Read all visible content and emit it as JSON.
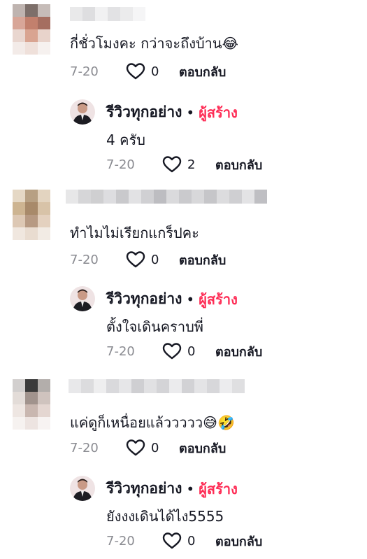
{
  "comments": [
    {
      "text": "กี่ชั่วโมงคะ กว่าจะถึงบ้าน😂",
      "date": "7-20",
      "likes": "0",
      "reply_label": "ตอบกลับ",
      "avatar_colors": [
        "#bfb4b0",
        "#7d6f6a",
        "#c6bcb8",
        "#d8a698",
        "#c2806d",
        "#a56e60",
        "#e9d6cf",
        "#d9a491",
        "#e8d3cb",
        "#f3ebe8",
        "#efe0da",
        "#f6f1ef"
      ],
      "reply": {
        "name": "รีวิวทุกอย่าง",
        "dot": "•",
        "creator_label": "ผู้สร้าง",
        "text": "4 ครับ",
        "date": "7-20",
        "likes": "2",
        "reply_label": "ตอบกลับ"
      }
    },
    {
      "text": "ทำไมไม่เรียกแกร็ปคะ",
      "date": "7-20",
      "likes": "0",
      "reply_label": "ตอบกลับ",
      "avatar_colors": [
        "#e5d8c5",
        "#b7a083",
        "#e3d4c0",
        "#cdb491",
        "#a88a6a",
        "#d8c3a8",
        "#ddc8b4",
        "#b79a83",
        "#e4d1bf",
        "#f0e7df",
        "#e9dcd0",
        "#f2ebe4"
      ],
      "reply": {
        "name": "รีวิวทุกอย่าง",
        "dot": "•",
        "creator_label": "ผู้สร้าง",
        "text": "ตั้งใจเดินคราบพี่",
        "date": "7-20",
        "likes": "0",
        "reply_label": "ตอบกลับ"
      }
    },
    {
      "text": "แค่ดูก็เหนื่อยแล้ววววว😅🤣",
      "date": "7-20",
      "likes": "0",
      "reply_label": "ตอบกลับ",
      "avatar_colors": [
        "#d2cfce",
        "#3a3a3a",
        "#b3aeab",
        "#e3dcd8",
        "#a1938d",
        "#cfc3be",
        "#eee6e2",
        "#c9b7b0",
        "#e4d6d1",
        "#f6f2f0",
        "#ede4e1",
        "#f7f3f2"
      ],
      "reply": {
        "name": "รีวิวทุกอย่าง",
        "dot": "•",
        "creator_label": "ผู้สร้าง",
        "text": "ยังงงเดินได้ไง5555",
        "date": "7-20",
        "likes": "0",
        "reply_label": "ตอบกลับ"
      }
    }
  ],
  "colors": {
    "creator": "#fe2c55",
    "meta_gray": "#8a8b91",
    "text": "#161823"
  }
}
